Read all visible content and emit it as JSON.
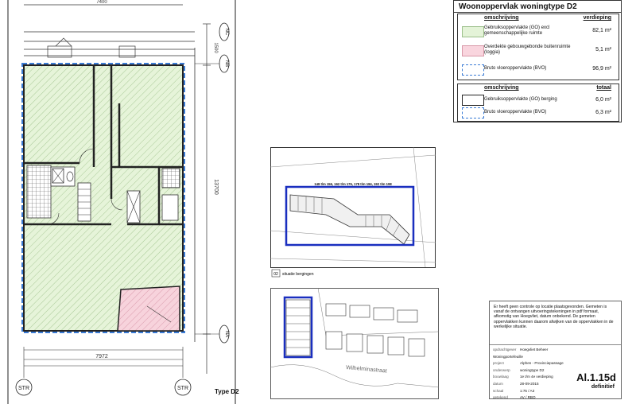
{
  "legend": {
    "title": "Woonoppervlak woningtype D2",
    "sec1": {
      "col1": "omschrijving",
      "col2": "verdieping"
    },
    "rows1": [
      {
        "color": "green",
        "label": "Gebruiksoppervlakte (GO) excl gemeenschappelijke ruimte",
        "value": "82,1 m²"
      },
      {
        "color": "pink",
        "label": "Overdekte gebouwgebonde buitenruimte (loggia)",
        "value": "5,1 m²"
      },
      {
        "color": "blue-dashed",
        "label": "Bruto vloeroppervlakte (BVO)",
        "value": "96,9 m²"
      }
    ],
    "sec2": {
      "col1": "omschrijving",
      "col2": "totaal"
    },
    "rows2": [
      {
        "color": "black-outline",
        "label": "Gebruiksoppervlakte (GO) berging",
        "value": "6,0 m²"
      },
      {
        "color": "blue-dashed",
        "label": "Bruto vloeroppervlakte (BVO)",
        "value": "6,3 m²"
      }
    ]
  },
  "plan": {
    "type_label": "Type D2",
    "dim_width": "7972",
    "dim_height": "13700",
    "dim_top": "7400",
    "dim_side": "1500",
    "grid_labels": [
      "NC",
      "NB",
      "NA"
    ],
    "str_label": "STR"
  },
  "site": {
    "numbers": "148 t/m 156, 162 t/m 176, 178 t/m 184, 192 t/m 198",
    "caption": "situatie bergingen",
    "caption_code": "02",
    "street": "Wilhelminastraat"
  },
  "titleblock": {
    "note": "Er heeft geen controle op locatie plaatsgevonden. Gemeten is vanaf de ontvangen uitvoeringstekeningen in pdf formaat, afkomstig van Hoegvliet, datum onbekend. De gemeten oppervlakken kunnen daarom afwijken van de oppervlakken in de werkelijke situatie.",
    "fields": [
      {
        "k": "opdrachtgever",
        "v": "Hoegvliet Beheer Woningportefeuille"
      },
      {
        "k": "project",
        "v": "Alphen - Provinciepassage"
      },
      {
        "k": "onderwerp",
        "v": "woningtype D2"
      },
      {
        "k": "bouwlaag",
        "v": "1e t/m 4e verdieping"
      },
      {
        "k": "datum",
        "v": "28-09-2015"
      },
      {
        "k": "schaal",
        "v": "1:75 / A3"
      },
      {
        "k": "getekend",
        "v": "AV / RBO"
      }
    ],
    "stamp": "Al.1.15d",
    "status": "definitief"
  }
}
